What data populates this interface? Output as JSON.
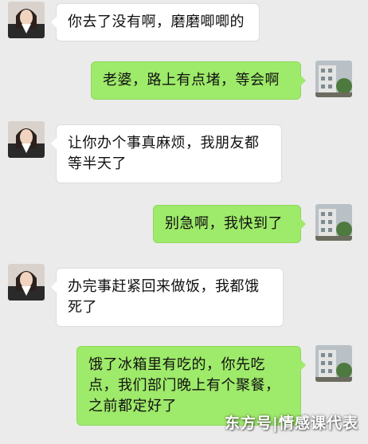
{
  "chat": {
    "messages": [
      {
        "side": "left",
        "text": "你去了没有啊，磨磨唧唧的"
      },
      {
        "side": "right",
        "text": "老婆，路上有点堵，等会啊"
      },
      {
        "side": "left",
        "text": "让你办个事真麻烦，我朋友都等半天了"
      },
      {
        "side": "right",
        "text": "别急啊，我快到了"
      },
      {
        "side": "left",
        "text": "办完事赶紧回来做饭，我都饿死了"
      },
      {
        "side": "right",
        "text": "饿了冰箱里有吃的，你先吃点，我们部门晚上有个聚餐，之前都定好了"
      }
    ]
  },
  "watermark": {
    "text": "东方号|情感课代表"
  },
  "colors": {
    "background": "#ebebeb",
    "incoming_bubble": "#ffffff",
    "outgoing_bubble": "#9eea6a"
  },
  "icons": {
    "incoming_avatar": "woman-avatar-icon",
    "outgoing_avatar": "building-avatar-icon"
  }
}
